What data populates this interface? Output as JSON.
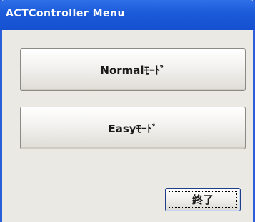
{
  "window": {
    "title": "ACTController Menu"
  },
  "buttons": {
    "normal_label": "Normalﾓｰﾄﾞ",
    "easy_label": "Easyﾓｰﾄﾞ",
    "exit_label": "終了"
  },
  "colors": {
    "titlebar": "#1b5ad9",
    "window_border": "#2a5fd9",
    "client_background": "#ebe9e4"
  }
}
